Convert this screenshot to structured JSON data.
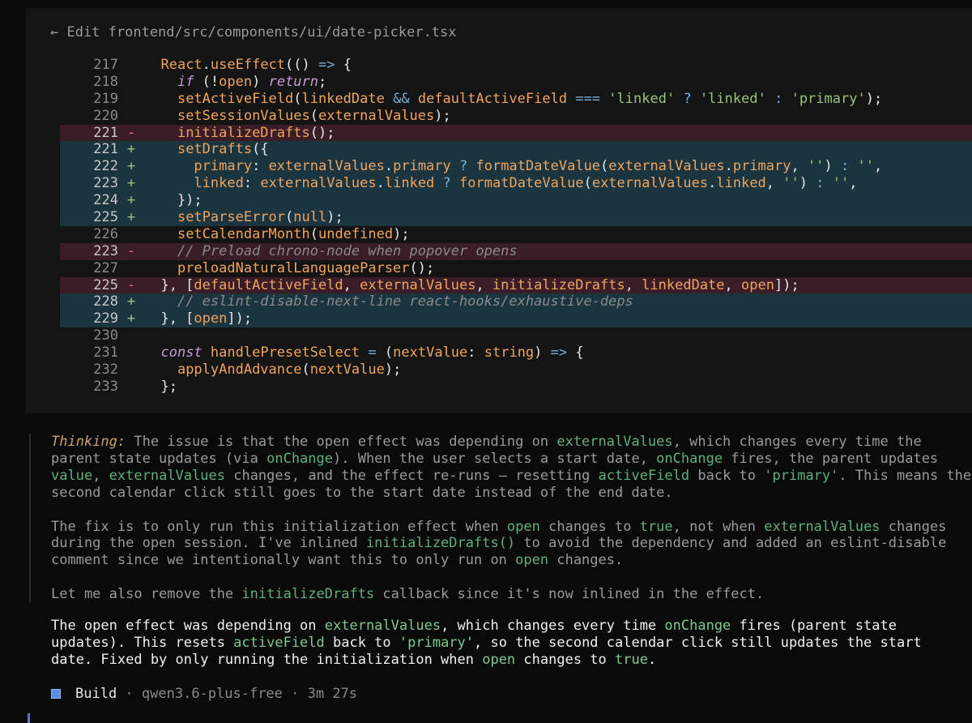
{
  "header": {
    "title": "← Edit frontend/src/components/ui/date-picker.tsx"
  },
  "code_lines": [
    {
      "ln": "217",
      "mark": "",
      "type": "ctx",
      "tokens": [
        [
          "plain",
          "  "
        ],
        [
          "fn",
          "React"
        ],
        [
          "plain",
          "."
        ],
        [
          "fn",
          "useEffect"
        ],
        [
          "plain",
          "(() "
        ],
        [
          "op",
          "=>"
        ],
        [
          "plain",
          " {"
        ]
      ]
    },
    {
      "ln": "218",
      "mark": "",
      "type": "ctx",
      "tokens": [
        [
          "plain",
          "    "
        ],
        [
          "kw",
          "if"
        ],
        [
          "plain",
          " (!"
        ],
        [
          "fn",
          "open"
        ],
        [
          "plain",
          ") "
        ],
        [
          "kw",
          "return"
        ],
        [
          "plain",
          ";"
        ]
      ]
    },
    {
      "ln": "219",
      "mark": "",
      "type": "ctx",
      "tokens": [
        [
          "plain",
          "    "
        ],
        [
          "fn",
          "setActiveField"
        ],
        [
          "plain",
          "("
        ],
        [
          "fn",
          "linkedDate"
        ],
        [
          "plain",
          " "
        ],
        [
          "op",
          "&&"
        ],
        [
          "plain",
          " "
        ],
        [
          "fn",
          "defaultActiveField"
        ],
        [
          "plain",
          " "
        ],
        [
          "op",
          "==="
        ],
        [
          "plain",
          " "
        ],
        [
          "str",
          "'linked'"
        ],
        [
          "plain",
          " "
        ],
        [
          "op",
          "?"
        ],
        [
          "plain",
          " "
        ],
        [
          "str",
          "'linked'"
        ],
        [
          "plain",
          " "
        ],
        [
          "op",
          ":"
        ],
        [
          "plain",
          " "
        ],
        [
          "str",
          "'primary'"
        ],
        [
          "plain",
          ");"
        ]
      ]
    },
    {
      "ln": "220",
      "mark": "",
      "type": "ctx",
      "tokens": [
        [
          "plain",
          "    "
        ],
        [
          "fn",
          "setSessionValues"
        ],
        [
          "plain",
          "("
        ],
        [
          "fn",
          "externalValues"
        ],
        [
          "plain",
          ");"
        ]
      ]
    },
    {
      "ln": "221",
      "mark": "-",
      "type": "del",
      "tokens": [
        [
          "plain",
          "    "
        ],
        [
          "fn",
          "initializeDrafts"
        ],
        [
          "plain",
          "();"
        ]
      ]
    },
    {
      "ln": "221",
      "mark": "+",
      "type": "add",
      "tokens": [
        [
          "plain",
          "    "
        ],
        [
          "fn",
          "setDrafts"
        ],
        [
          "plain",
          "({"
        ]
      ]
    },
    {
      "ln": "222",
      "mark": "+",
      "type": "add",
      "tokens": [
        [
          "plain",
          "      "
        ],
        [
          "fn",
          "primary"
        ],
        [
          "plain",
          ": "
        ],
        [
          "fn",
          "externalValues"
        ],
        [
          "plain",
          "."
        ],
        [
          "fn",
          "primary"
        ],
        [
          "plain",
          " "
        ],
        [
          "op",
          "?"
        ],
        [
          "plain",
          " "
        ],
        [
          "fn",
          "formatDateValue"
        ],
        [
          "plain",
          "("
        ],
        [
          "fn",
          "externalValues"
        ],
        [
          "plain",
          "."
        ],
        [
          "fn",
          "primary"
        ],
        [
          "plain",
          ", "
        ],
        [
          "str",
          "''"
        ],
        [
          "plain",
          ") "
        ],
        [
          "op",
          ":"
        ],
        [
          "plain",
          " "
        ],
        [
          "str",
          "''"
        ],
        [
          "plain",
          ","
        ]
      ]
    },
    {
      "ln": "223",
      "mark": "+",
      "type": "add",
      "tokens": [
        [
          "plain",
          "      "
        ],
        [
          "fn",
          "linked"
        ],
        [
          "plain",
          ": "
        ],
        [
          "fn",
          "externalValues"
        ],
        [
          "plain",
          "."
        ],
        [
          "fn",
          "linked"
        ],
        [
          "plain",
          " "
        ],
        [
          "op",
          "?"
        ],
        [
          "plain",
          " "
        ],
        [
          "fn",
          "formatDateValue"
        ],
        [
          "plain",
          "("
        ],
        [
          "fn",
          "externalValues"
        ],
        [
          "plain",
          "."
        ],
        [
          "fn",
          "linked"
        ],
        [
          "plain",
          ", "
        ],
        [
          "str",
          "''"
        ],
        [
          "plain",
          ") "
        ],
        [
          "op",
          ":"
        ],
        [
          "plain",
          " "
        ],
        [
          "str",
          "''"
        ],
        [
          "plain",
          ","
        ]
      ]
    },
    {
      "ln": "224",
      "mark": "+",
      "type": "add",
      "tokens": [
        [
          "plain",
          "    });"
        ]
      ]
    },
    {
      "ln": "225",
      "mark": "+",
      "type": "add",
      "tokens": [
        [
          "plain",
          "    "
        ],
        [
          "fn",
          "setParseError"
        ],
        [
          "plain",
          "("
        ],
        [
          "fn",
          "null"
        ],
        [
          "plain",
          ");"
        ]
      ]
    },
    {
      "ln": "226",
      "mark": "",
      "type": "ctx",
      "tokens": [
        [
          "plain",
          "    "
        ],
        [
          "fn",
          "setCalendarMonth"
        ],
        [
          "plain",
          "("
        ],
        [
          "fn",
          "undefined"
        ],
        [
          "plain",
          ");"
        ]
      ]
    },
    {
      "ln": "223",
      "mark": "-",
      "type": "del",
      "tokens": [
        [
          "plain",
          "    "
        ],
        [
          "cm",
          "// Preload chrono-node when popover opens"
        ]
      ]
    },
    {
      "ln": "227",
      "mark": "",
      "type": "ctx",
      "tokens": [
        [
          "plain",
          "    "
        ],
        [
          "fn",
          "preloadNaturalLanguageParser"
        ],
        [
          "plain",
          "();"
        ]
      ]
    },
    {
      "ln": "225",
      "mark": "-",
      "type": "del",
      "tokens": [
        [
          "plain",
          "  }, ["
        ],
        [
          "fn",
          "defaultActiveField"
        ],
        [
          "plain",
          ", "
        ],
        [
          "fn",
          "externalValues"
        ],
        [
          "plain",
          ", "
        ],
        [
          "fn",
          "initializeDrafts"
        ],
        [
          "plain",
          ", "
        ],
        [
          "fn",
          "linkedDate"
        ],
        [
          "plain",
          ", "
        ],
        [
          "fn",
          "open"
        ],
        [
          "plain",
          "]);"
        ]
      ]
    },
    {
      "ln": "228",
      "mark": "+",
      "type": "add",
      "tokens": [
        [
          "plain",
          "    "
        ],
        [
          "cm",
          "// eslint-disable-next-line react-hooks/exhaustive-deps"
        ]
      ]
    },
    {
      "ln": "229",
      "mark": "+",
      "type": "add",
      "tokens": [
        [
          "plain",
          "  }, ["
        ],
        [
          "fn",
          "open"
        ],
        [
          "plain",
          "]);"
        ]
      ]
    },
    {
      "ln": "230",
      "mark": "",
      "type": "ctx",
      "tokens": []
    },
    {
      "ln": "231",
      "mark": "",
      "type": "ctx",
      "tokens": [
        [
          "plain",
          "  "
        ],
        [
          "kw",
          "const"
        ],
        [
          "plain",
          " "
        ],
        [
          "fn",
          "handlePresetSelect"
        ],
        [
          "plain",
          " "
        ],
        [
          "op",
          "="
        ],
        [
          "plain",
          " ("
        ],
        [
          "fn",
          "nextValue"
        ],
        [
          "plain",
          ": "
        ],
        [
          "fn",
          "string"
        ],
        [
          "plain",
          ") "
        ],
        [
          "op",
          "=>"
        ],
        [
          "plain",
          " {"
        ]
      ]
    },
    {
      "ln": "232",
      "mark": "",
      "type": "ctx",
      "tokens": [
        [
          "plain",
          "    "
        ],
        [
          "fn",
          "applyAndAdvance"
        ],
        [
          "plain",
          "("
        ],
        [
          "fn",
          "nextValue"
        ],
        [
          "plain",
          ");"
        ]
      ]
    },
    {
      "ln": "233",
      "mark": "",
      "type": "ctx",
      "tokens": [
        [
          "plain",
          "  };"
        ]
      ]
    }
  ],
  "thinking": {
    "label": "Thinking:",
    "paragraphs": [
      [
        [
          "t",
          " The issue is that the open effect was depending on "
        ],
        [
          "h",
          "externalValues"
        ],
        [
          "t",
          ", which changes every time the parent state updates (via "
        ],
        [
          "h",
          "onChange"
        ],
        [
          "t",
          "). When the user selects a start date, "
        ],
        [
          "h",
          "onChange"
        ],
        [
          "t",
          " fires, the parent updates "
        ],
        [
          "h",
          "value"
        ],
        [
          "t",
          ", "
        ],
        [
          "h",
          "externalValues"
        ],
        [
          "t",
          " changes, and the effect re-runs — resetting "
        ],
        [
          "h",
          "activeField"
        ],
        [
          "t",
          " back to "
        ],
        [
          "h",
          "'primary'"
        ],
        [
          "t",
          ". This means the second calendar click still goes to the start date instead of the end date."
        ]
      ],
      [
        [
          "t",
          "The fix is to only run this initialization effect when "
        ],
        [
          "h",
          "open"
        ],
        [
          "t",
          " changes to "
        ],
        [
          "h",
          "true"
        ],
        [
          "t",
          ", not when "
        ],
        [
          "h",
          "externalValues"
        ],
        [
          "t",
          " changes during the open session. I've inlined "
        ],
        [
          "h",
          "initializeDrafts()"
        ],
        [
          "t",
          " to avoid the dependency and added an eslint-disable comment since we intentionally want this to only run on "
        ],
        [
          "h",
          "open"
        ],
        [
          "t",
          " changes."
        ]
      ],
      [
        [
          "t",
          "Let me also remove the "
        ],
        [
          "h",
          "initializeDrafts"
        ],
        [
          "t",
          " callback since it's now inlined in the effect."
        ]
      ]
    ]
  },
  "answer": [
    [
      "t",
      "The open effect was depending on "
    ],
    [
      "h",
      "externalValues"
    ],
    [
      "t",
      ", which changes every time "
    ],
    [
      "h",
      "onChange"
    ],
    [
      "t",
      " fires (parent state updates). This resets "
    ],
    [
      "h",
      "activeField"
    ],
    [
      "t",
      " back to "
    ],
    [
      "h",
      "'primary'"
    ],
    [
      "t",
      ", so the second calendar click still updates the start date. Fixed by only running the initialization when "
    ],
    [
      "h",
      "open"
    ],
    [
      "t",
      " changes to "
    ],
    [
      "h",
      "true"
    ],
    [
      "t",
      "."
    ]
  ],
  "footer": {
    "build_label": "Build",
    "model": "qwen3.6-plus-free",
    "duration": "3m 27s",
    "separator": " · "
  },
  "colors": {
    "background": "#0a0a0a",
    "panel": "#141414",
    "deleted_line": "#3b1d27",
    "added_line": "#1a3540",
    "function": "#f0a45d",
    "keyword": "#c49bd6",
    "string": "#98c379",
    "operator": "#7aaed6",
    "highlight": "#5fb07a",
    "thinking_label": "#c9a26b",
    "build_square": "#5a8ee0"
  }
}
